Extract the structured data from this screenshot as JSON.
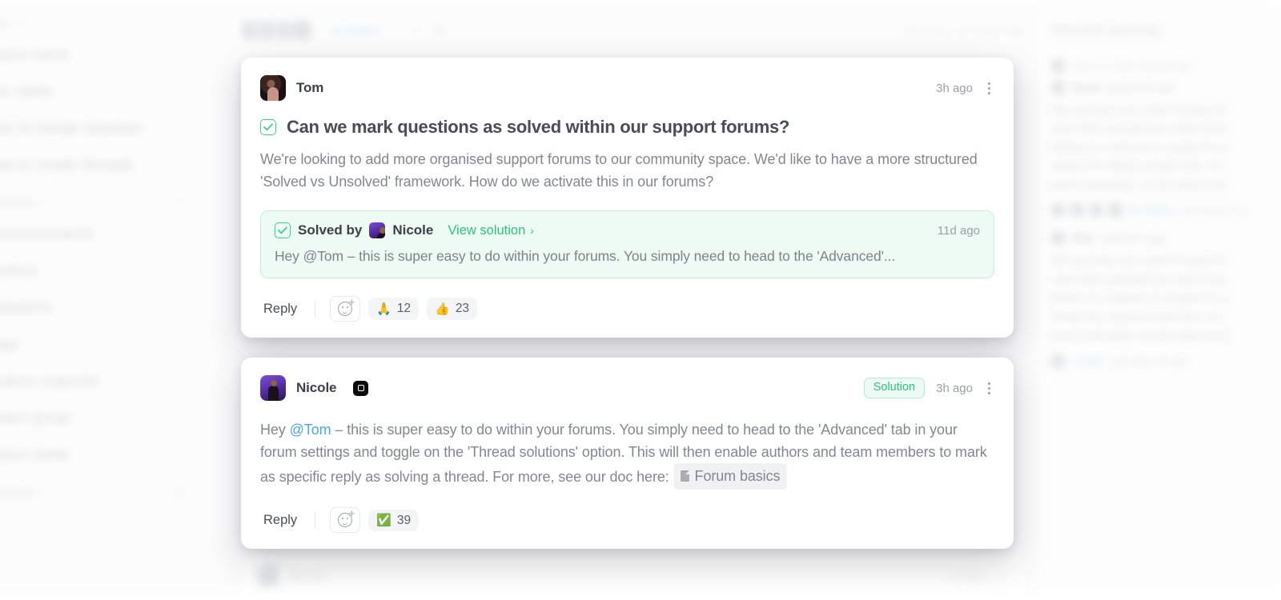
{
  "background": {
    "sidebar": {
      "items": [
        {
          "label": "Docs",
          "caret": "▾",
          "small": true
        },
        {
          "label": "Space name"
        },
        {
          "label": "Doc name"
        },
        {
          "label": "How to merge requests"
        },
        {
          "label": "How to create threads"
        },
        {
          "label": "Channels",
          "caret": "▾",
          "plus": "+",
          "small": true
        },
        {
          "label": "Announcements"
        },
        {
          "label": "Product"
        },
        {
          "label": "Questions"
        },
        {
          "label": "Bugs"
        },
        {
          "label": "Feature requests"
        },
        {
          "label": "Space group"
        },
        {
          "label": "Space name"
        },
        {
          "label": "Channels",
          "caret": "▾",
          "plus": "+",
          "small": true
        }
      ]
    },
    "topbar": {
      "avatar_overflow": "+3",
      "replies": "19 replies",
      "reaction_count": "39",
      "last_reply": "Last reply 12 hours ago"
    },
    "recent_activity": {
      "heading": "Recent activity",
      "items": [
        {
          "thread_title": "This is a first thread title",
          "author": "Kyran",
          "action": "posted 3h ago",
          "body_lines": [
            "We currently use Label Groups for",
            "view that's grouped by Label Grou",
            "tickets in a release or scoped for a",
            "shows the oldest version first. Is t",
            "(even manually), so the latest vers"
          ],
          "avatar_overflow": "+3",
          "replies": "50 replies",
          "last_reply": "Last reply 2h a"
        },
        {
          "thread_title": "",
          "author": "Ollie",
          "action": "replied 2h ago",
          "body_lines": [
            "We currently use Label Groups for",
            "view that's grouped by Label Grou",
            "tickets in a release or scoped for a",
            "shows the oldest version first. Is t",
            "(even manually), so the latest vers"
          ],
          "replies": "1 reply",
          "last_reply": "Last reply 1h ago"
        }
      ]
    },
    "bottom_card": {
      "author": "Nicole",
      "timestamp": "3h ago"
    }
  },
  "thread": {
    "question_card": {
      "author": "Tom",
      "timestamp": "3h ago",
      "title": "Can we mark questions as solved within our support forums?",
      "body": "We're looking to add more organised support forums to our community space. We'd like to have a more structured 'Solved vs Unsolved' framework. How do we activate this in our forums?",
      "solved_banner": {
        "solved_by_label": "Solved by",
        "solver": "Nicole",
        "view_solution_label": "View solution",
        "chevron": "›",
        "timestamp": "11d ago",
        "excerpt": "Hey @Tom – this is super easy to do within your forums. You simply need to head to the 'Advanced'..."
      },
      "actions": {
        "reply_label": "Reply",
        "add_reaction_icon": "add-reaction-icon",
        "reactions": [
          {
            "emoji": "🙏",
            "count": "12"
          },
          {
            "emoji": "👍",
            "count": "23"
          }
        ]
      }
    },
    "answer_card": {
      "author": "Nicole",
      "org_badge_icon": "org-logo-icon",
      "solution_badge": "Solution",
      "timestamp": "3h ago",
      "body_part1": "Hey ",
      "mention": "@Tom",
      "body_part2": " – this is super easy to do within your forums. You simply need to head to the 'Advanced' tab in your forum settings and toggle on the 'Thread solutions' option. This will then enable authors and team members to mark as specific reply as solving a thread. For more, see our doc here: ",
      "doc_chip_label": "Forum basics",
      "actions": {
        "reply_label": "Reply",
        "add_reaction_icon": "add-reaction-icon",
        "reactions": [
          {
            "emoji": "✅",
            "count": "39"
          }
        ]
      }
    }
  },
  "colors": {
    "accent_green": "#2ec27e",
    "check_green": "#3ccf8e",
    "banner_bg": "#eefaf4",
    "banner_border": "#c6ecdb",
    "mention_blue": "#4aa8e0",
    "text_primary": "#3d4046",
    "text_secondary": "#83878d",
    "text_muted": "#9ba0a6"
  }
}
